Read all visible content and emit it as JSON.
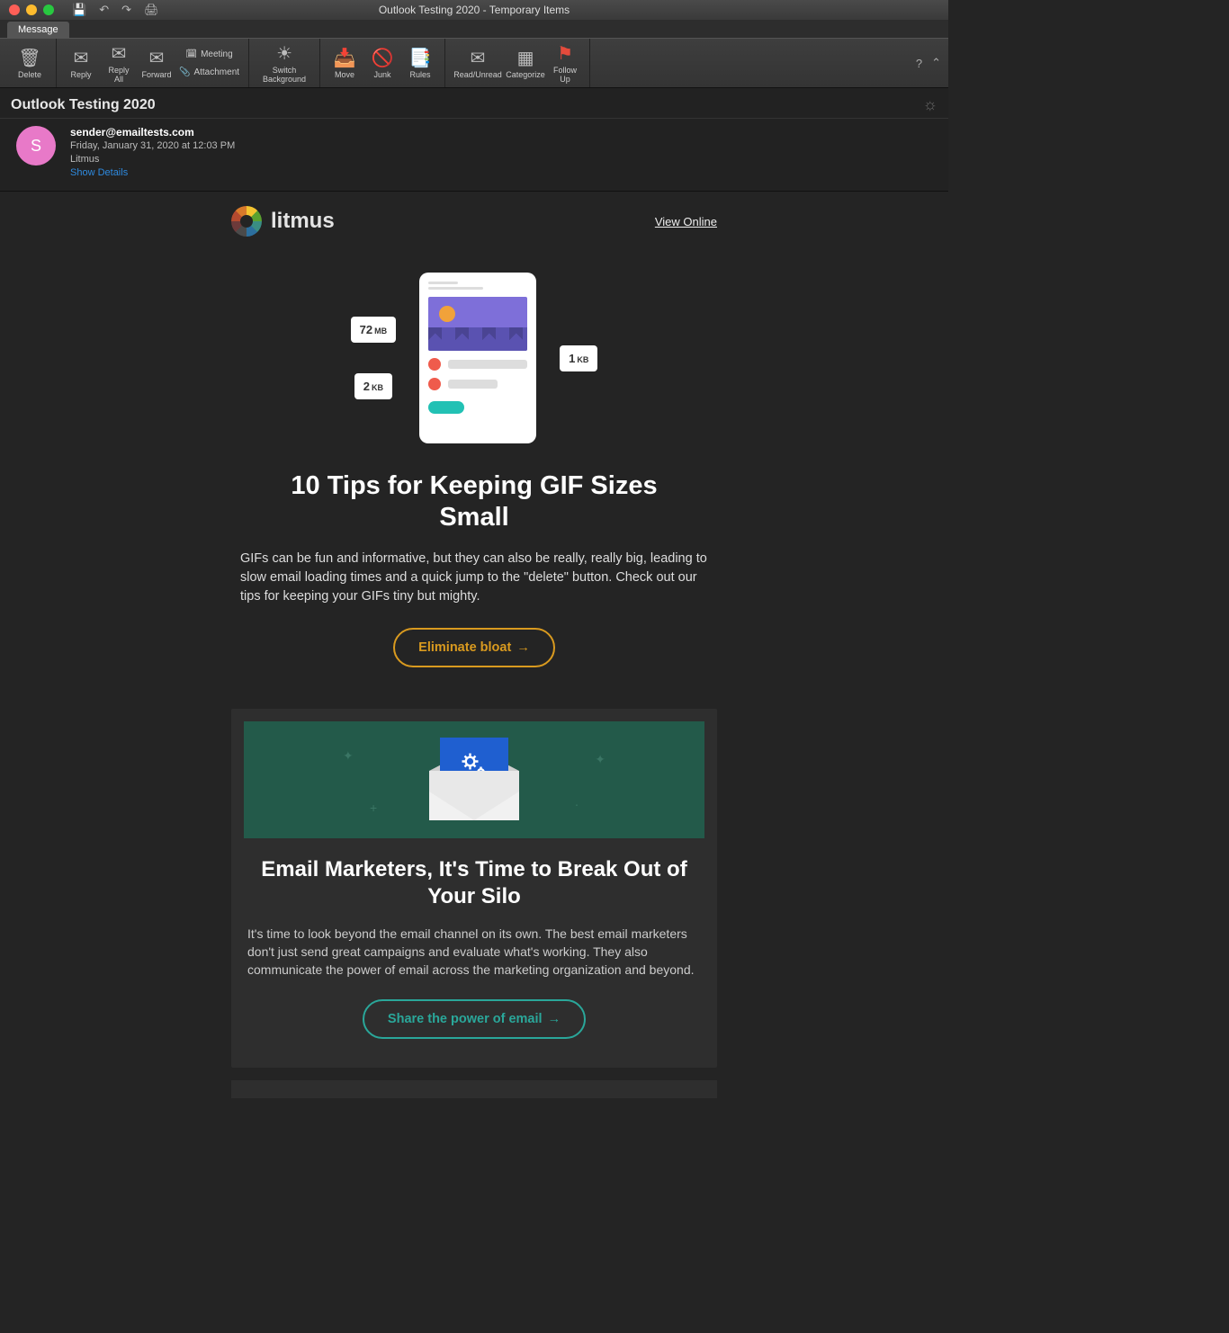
{
  "window": {
    "title": "Outlook Testing 2020 - Temporary Items"
  },
  "tab": "Message",
  "ribbon": {
    "delete": "Delete",
    "reply": "Reply",
    "reply_all": "Reply\nAll",
    "forward": "Forward",
    "meeting": "Meeting",
    "attachment": "Attachment",
    "switch_bg": "Switch\nBackground",
    "move": "Move",
    "junk": "Junk",
    "rules": "Rules",
    "read_unread": "Read/Unread",
    "categorize": "Categorize",
    "follow_up": "Follow\nUp"
  },
  "message": {
    "subject": "Outlook Testing 2020",
    "avatar_letter": "S",
    "sender": "sender@emailtests.com",
    "date": "Friday, January 31, 2020 at 12:03 PM",
    "from_name": "Litmus",
    "show_details": "Show Details"
  },
  "email": {
    "brand": "litmus",
    "view_online": "View Online",
    "hero": {
      "chip72": "72",
      "chip72_unit": "MB",
      "chip2": "2",
      "chip2_unit": "KB",
      "chip1": "1",
      "chip1_unit": "KB"
    },
    "h1": "10 Tips for Keeping GIF Sizes Small",
    "p1": "GIFs can be fun and informative, but they can also be really, really big, leading to slow email loading times and a quick jump to the \"delete\" button. Check out our tips for keeping your GIFs tiny but mighty.",
    "cta1": "Eliminate bloat",
    "h2": "Email Marketers, It's Time to Break Out of Your Silo",
    "p2": "It's time to look beyond the email channel on its own. The best email marketers don't just send great campaigns and evaluate what's working. They also communicate the power of email across the marketing organization and beyond.",
    "cta2": "Share the power of email"
  }
}
